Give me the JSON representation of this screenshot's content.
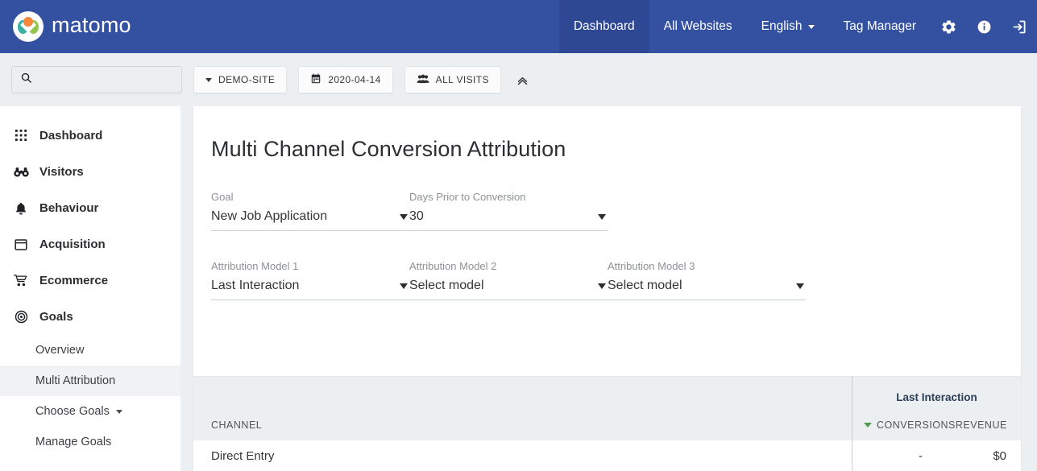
{
  "colors": {
    "navbar": "#3450a1",
    "navbar_active": "#2f4894",
    "page_bg": "#eceff1",
    "sort_green": "#4e9a51",
    "group_header_text": "#2d4059"
  },
  "topnav": {
    "brand": "matomo",
    "items": [
      {
        "label": "Dashboard",
        "active": true,
        "has_caret": false
      },
      {
        "label": "All Websites",
        "active": false,
        "has_caret": false
      },
      {
        "label": "English",
        "active": false,
        "has_caret": true
      },
      {
        "label": "Tag Manager",
        "active": false,
        "has_caret": false
      }
    ],
    "icons": [
      {
        "name": "gear-icon"
      },
      {
        "name": "info-icon"
      },
      {
        "name": "sign-in-icon"
      }
    ]
  },
  "toolbar": {
    "search": {
      "value": "",
      "placeholder": ""
    },
    "site_selector": "DEMO-SITE",
    "date_selector": "2020-04-14",
    "segment_selector": "ALL VISITS",
    "collapse_label": ""
  },
  "sidebar": {
    "items": [
      {
        "label": "Dashboard",
        "icon": "grid-icon"
      },
      {
        "label": "Visitors",
        "icon": "binoculars-icon"
      },
      {
        "label": "Behaviour",
        "icon": "bell-icon"
      },
      {
        "label": "Acquisition",
        "icon": "browser-window-icon"
      },
      {
        "label": "Ecommerce",
        "icon": "shopping-cart-icon"
      },
      {
        "label": "Goals",
        "icon": "bullseye-icon"
      }
    ],
    "subitems": [
      {
        "label": "Overview",
        "active": false,
        "has_caret": false
      },
      {
        "label": "Multi Attribution",
        "active": true,
        "has_caret": false
      },
      {
        "label": "Choose Goals",
        "active": false,
        "has_caret": true
      },
      {
        "label": "Manage Goals",
        "active": false,
        "has_caret": false
      }
    ]
  },
  "main": {
    "title": "Multi Channel Conversion Attribution",
    "fields_row1": [
      {
        "label": "Goal",
        "value": "New Job Application"
      },
      {
        "label": "Days Prior to Conversion",
        "value": "30"
      }
    ],
    "fields_row2": [
      {
        "label": "Attribution Model 1",
        "value": "Last Interaction"
      },
      {
        "label": "Attribution Model 2",
        "value": "Select model"
      },
      {
        "label": "Attribution Model 3",
        "value": "Select model"
      }
    ],
    "table": {
      "channel_header": "CHANNEL",
      "group_header": "Last Interaction",
      "col_conversions": "CONVERSIONS",
      "col_revenue": "REVENUE",
      "sorted_by": "CONVERSIONS",
      "rows": [
        {
          "channel": "Direct Entry",
          "conversions": "-",
          "revenue": "$0"
        }
      ]
    }
  }
}
